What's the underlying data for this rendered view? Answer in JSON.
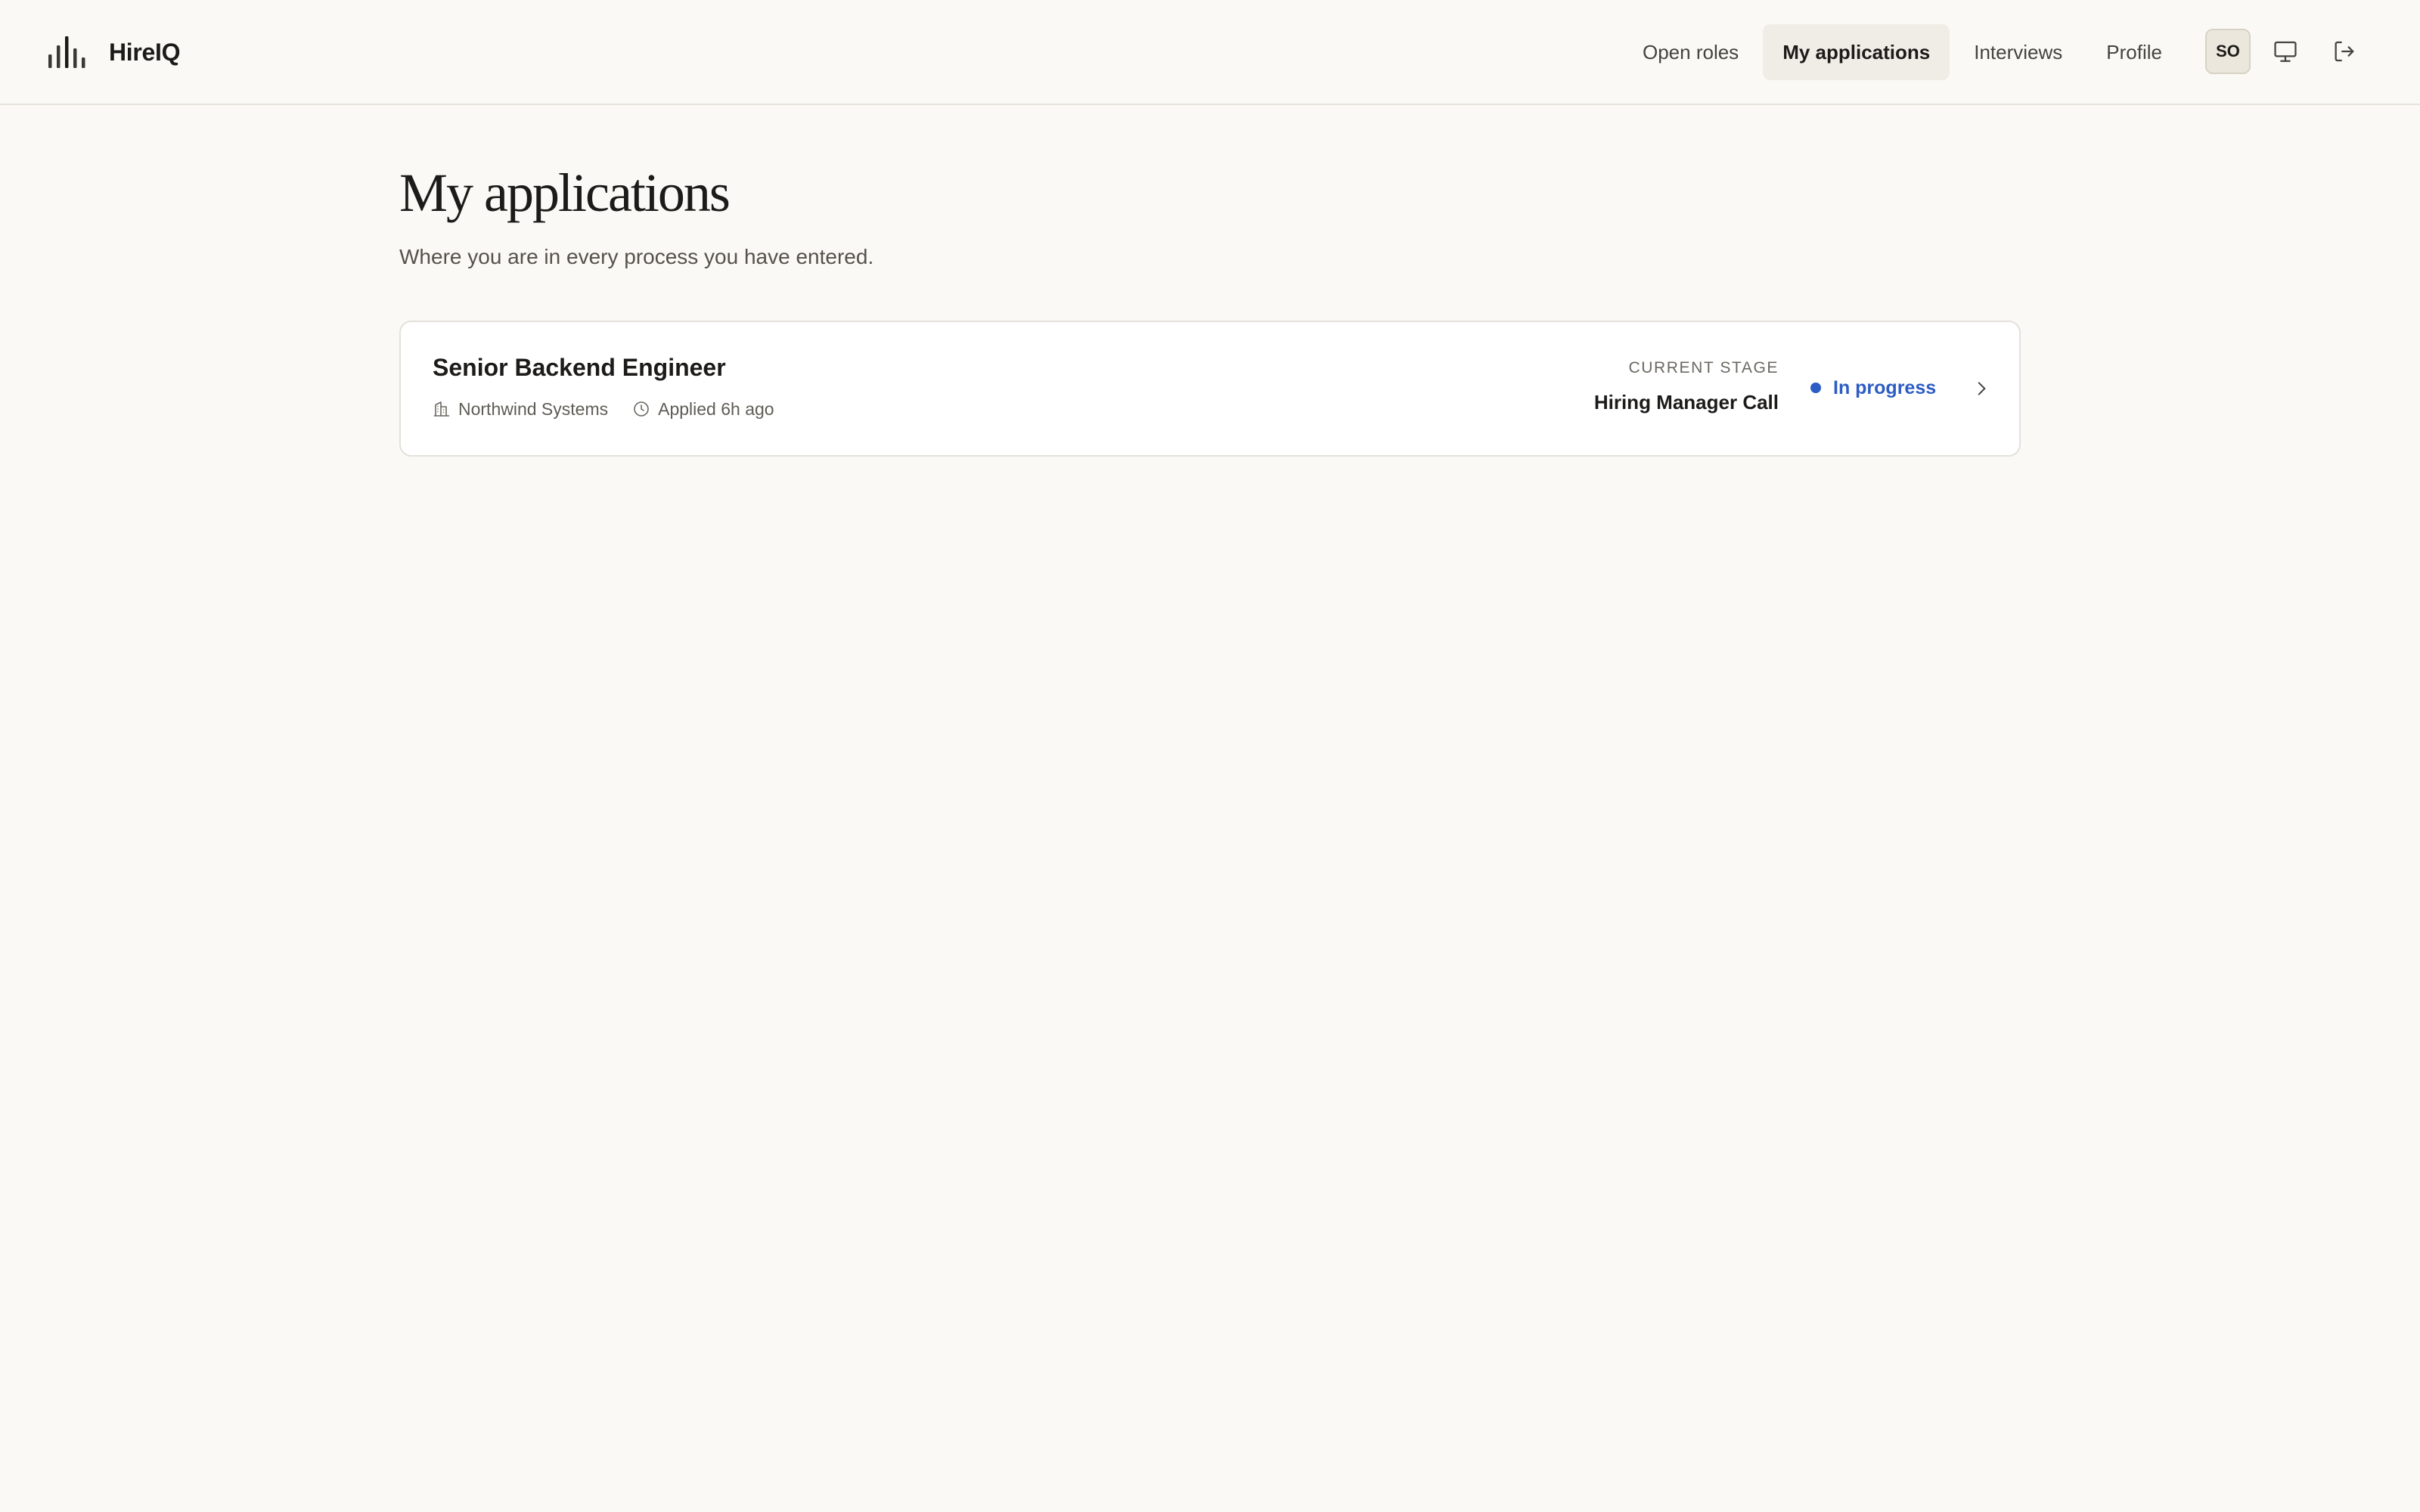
{
  "app": {
    "name": "HireIQ",
    "logo_icon": "bar-chart-logo-icon"
  },
  "nav": {
    "items": [
      {
        "label": "Open roles",
        "active": false
      },
      {
        "label": "My applications",
        "active": true
      },
      {
        "label": "Interviews",
        "active": false
      },
      {
        "label": "Profile",
        "active": false
      }
    ]
  },
  "user": {
    "initials": "SO"
  },
  "header_actions": {
    "display_icon": "monitor-icon",
    "logout_icon": "logout-icon"
  },
  "page": {
    "title": "My applications",
    "subtitle": "Where you are in every process you have entered."
  },
  "applications": [
    {
      "title": "Senior Backend Engineer",
      "company": "Northwind Systems",
      "company_icon": "building-icon",
      "applied": "Applied 6h ago",
      "applied_icon": "clock-icon",
      "stage_label": "Current stage",
      "stage": "Hiring Manager Call",
      "status": "In progress",
      "status_color": "#2c5cc5",
      "open_icon": "chevron-right-icon"
    }
  ],
  "colors": {
    "background": "#faf9f5",
    "accent": "#2c5cc5",
    "active_nav_bg": "#efede6"
  }
}
